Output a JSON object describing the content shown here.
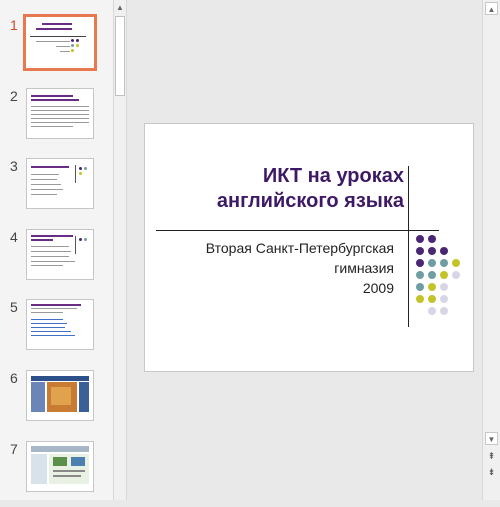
{
  "slide": {
    "title": "ИКТ на уроках английского языка",
    "subtitle": "Вторая Санкт-Петербургская гимназия",
    "year": "2009"
  },
  "thumbnails": [
    {
      "number": "1",
      "selected": true
    },
    {
      "number": "2",
      "selected": false
    },
    {
      "number": "3",
      "selected": false
    },
    {
      "number": "4",
      "selected": false
    },
    {
      "number": "5",
      "selected": false
    },
    {
      "number": "6",
      "selected": false
    },
    {
      "number": "7",
      "selected": false
    }
  ],
  "colors": {
    "title": "#3e1a66",
    "dot_purple": "#4a2673",
    "dot_teal": "#6f9ea2",
    "dot_olive": "#c3c42a",
    "dot_lavender": "#d8d6e6",
    "selection": "#e8794f"
  },
  "icons": {
    "scroll_up": "▲",
    "scroll_down": "▼",
    "prev_slide": "⇞",
    "next_slide": "⇟"
  }
}
